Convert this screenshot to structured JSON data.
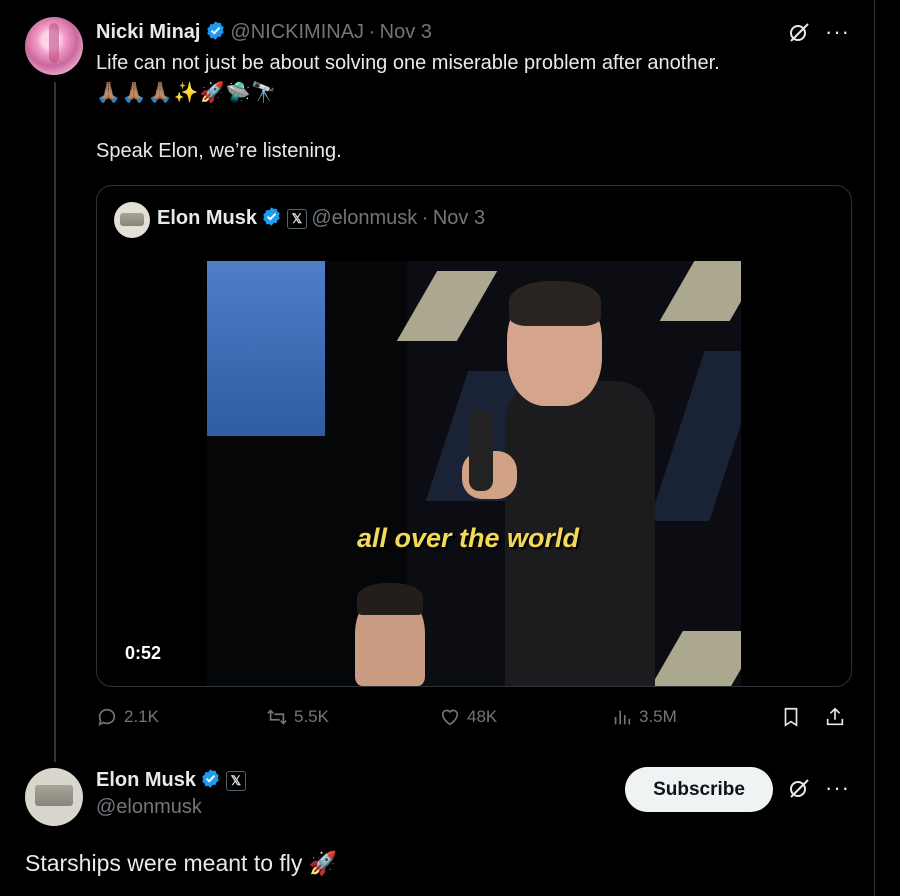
{
  "tweet": {
    "author": {
      "name": "Nicki Minaj",
      "handle": "@NICKIMINAJ",
      "date": "Nov 3",
      "verified": true
    },
    "text_line1": "Life can not just be about solving one miserable problem after another.",
    "emoji_line": "🙏🏽🙏🏽🙏🏽✨🚀🛸🔭",
    "text_line2": "Speak Elon, we’re listening.",
    "quote": {
      "author_name": "Elon Musk",
      "author_handle": "@elonmusk",
      "date": "Nov 3",
      "affiliate_badge": "𝕏",
      "video": {
        "caption": "all over the world",
        "duration": "0:52"
      }
    },
    "actions": {
      "replies": "2.1K",
      "reposts": "5.5K",
      "likes": "48K",
      "views": "3.5M"
    }
  },
  "reply": {
    "author": {
      "name": "Elon Musk",
      "handle": "@elonmusk",
      "affiliate_badge": "𝕏"
    },
    "subscribe_label": "Subscribe",
    "text": "Starships were meant to fly 🚀"
  },
  "more_icon_text": "···",
  "colors": {
    "background": "#000000",
    "text": "#e7e9ea",
    "secondary": "#71767b",
    "verified_blue": "#1d9bf0",
    "caption_yellow": "#f2d95a"
  }
}
